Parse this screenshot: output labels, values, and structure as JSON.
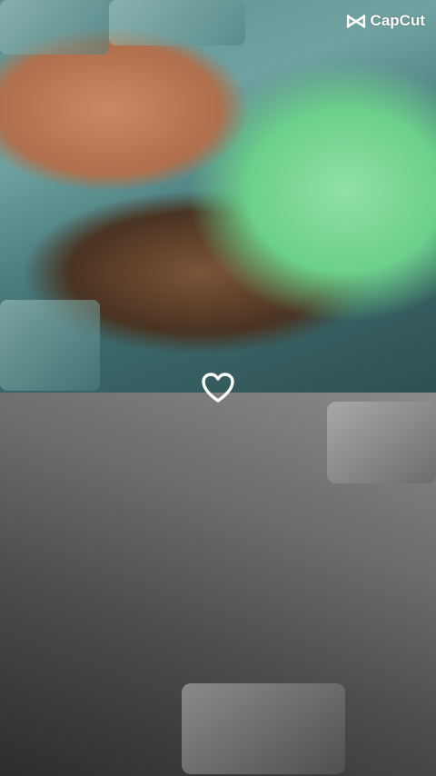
{
  "watermark": {
    "text": "CapCut",
    "icon": "capcut-logo-icon",
    "color": "#ffffff"
  },
  "divider": {
    "icon": "heart-outline-icon",
    "color": "#ffffff"
  },
  "panels": {
    "top": {
      "style": "color"
    },
    "bottom": {
      "style": "black-and-white"
    }
  }
}
